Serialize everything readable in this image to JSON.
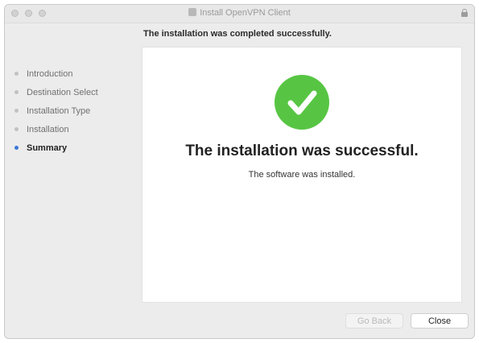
{
  "window": {
    "title": "Install OpenVPN Client"
  },
  "header": {
    "text": "The installation was completed successfully."
  },
  "sidebar": {
    "steps": [
      {
        "label": "Introduction",
        "active": false
      },
      {
        "label": "Destination Select",
        "active": false
      },
      {
        "label": "Installation Type",
        "active": false
      },
      {
        "label": "Installation",
        "active": false
      },
      {
        "label": "Summary",
        "active": true
      }
    ]
  },
  "main": {
    "status_icon": "success-checkmark-icon",
    "heading": "The installation was successful.",
    "subtext": "The software was installed."
  },
  "footer": {
    "back_label": "Go Back",
    "close_label": "Close"
  },
  "colors": {
    "success_green": "#57c543",
    "active_step_dot": "#3b78d8"
  }
}
